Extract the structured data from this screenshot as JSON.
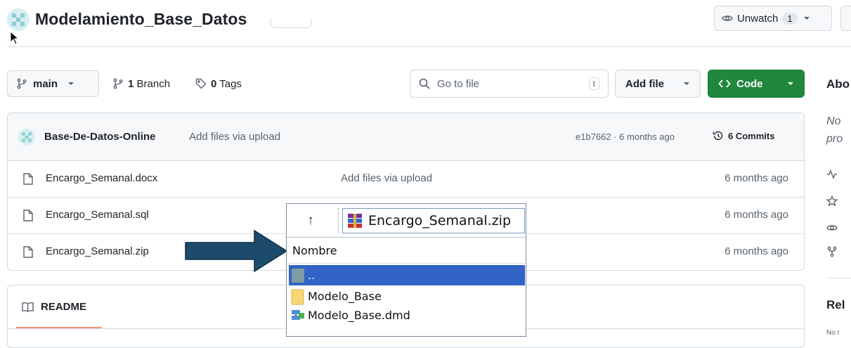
{
  "header": {
    "repo_name": "Modelamiento_Base_Datos",
    "unwatch_label": "Unwatch",
    "watch_count": "1"
  },
  "toolbar": {
    "branch": "main",
    "branch_count": "1",
    "branch_label": "Branch",
    "tag_count": "0",
    "tag_label": "Tags",
    "goto_placeholder": "Go to file",
    "goto_shortcut": "t",
    "add_file_label": "Add file",
    "code_label": "Code"
  },
  "commit": {
    "author": "Base-De-Datos-Online",
    "message": "Add files via upload",
    "meta": "e1b7662 · 6 months ago",
    "commits_label": "6 Commits"
  },
  "files": [
    {
      "name": "Encargo_Semanal.docx",
      "message": "Add files via upload",
      "date": "6 months ago"
    },
    {
      "name": "Encargo_Semanal.sql",
      "message": "",
      "date": "6 months ago"
    },
    {
      "name": "Encargo_Semanal.zip",
      "message": "",
      "date": "6 months ago"
    }
  ],
  "readme": {
    "label": "README"
  },
  "sidebar": {
    "about_heading": "Abo",
    "about_desc_line1": "No",
    "about_desc_line2": "pro",
    "releases_heading": "Rel",
    "releases_note": "No r"
  },
  "explorer": {
    "path": "Encargo_Semanal.zip",
    "column_header": "Nombre",
    "items": [
      {
        "name": "..",
        "icon": "parent-folder-icon"
      },
      {
        "name": "Modelo_Base",
        "icon": "folder-icon"
      },
      {
        "name": "Modelo_Base.dmd",
        "icon": "dmd-file-icon"
      }
    ]
  },
  "colors": {
    "code_button": "#1f883d",
    "selection": "#3164c4",
    "arrow": "#1d4b6b",
    "readme_accent": "#fd8c73"
  }
}
